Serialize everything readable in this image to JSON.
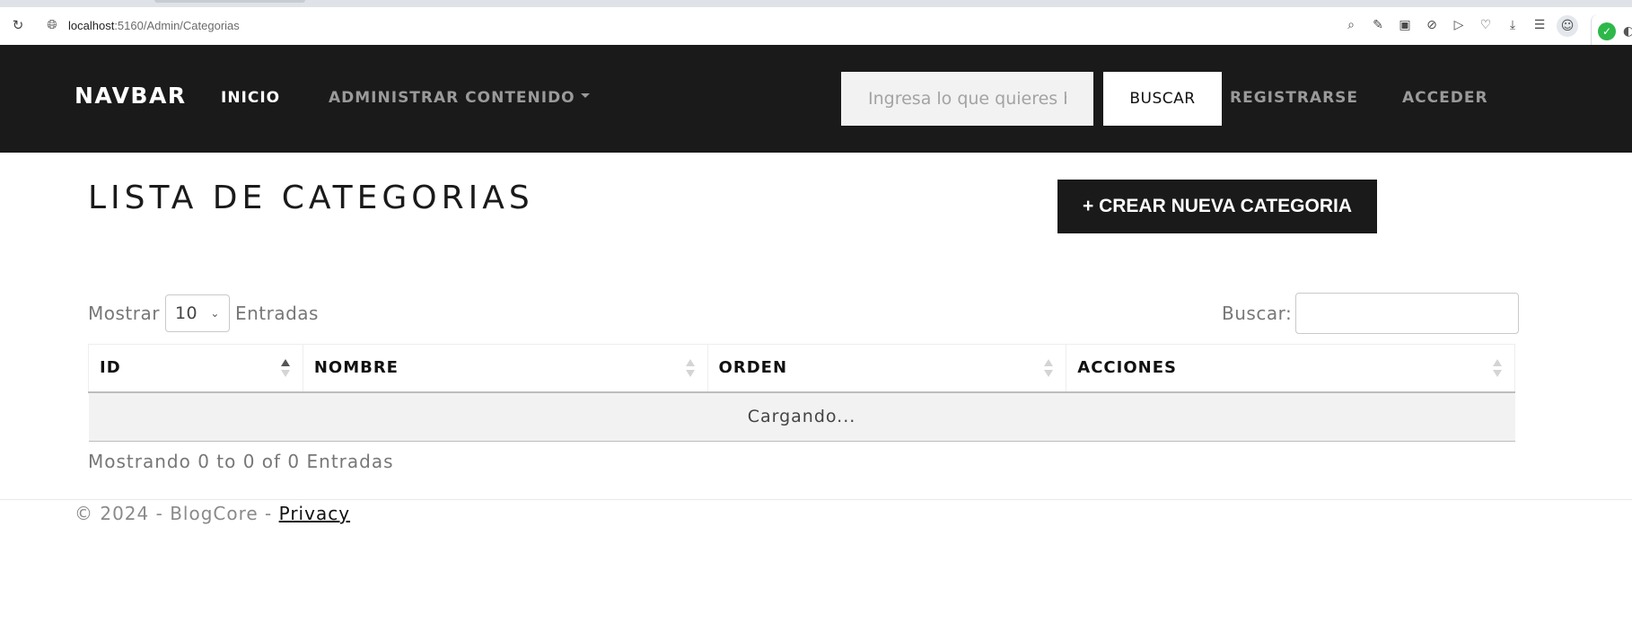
{
  "browser": {
    "url_host": "localhost",
    "url_rest": ":5160/Admin/Categorias",
    "toolbar_icons": [
      "zoom-icon",
      "edit-icon",
      "camera-icon",
      "shield-icon",
      "send-icon",
      "heart-icon",
      "download-icon",
      "menu-icon",
      "profile-icon"
    ]
  },
  "navbar": {
    "brand": "NAVBAR",
    "inicio": "INICIO",
    "admin": "ADMINISTRAR CONTENIDO",
    "search_placeholder": "Ingresa lo que quieres buscar",
    "search_button": "BUSCAR",
    "registrarse": "REGISTRARSE",
    "acceder": "ACCEDER"
  },
  "main": {
    "title": "LISTA DE CATEGORIAS",
    "create_button": "+ CREAR NUEVA CATEGORIA",
    "show_label": "Mostrar",
    "page_length": "10",
    "entries_label": "Entradas",
    "filter_label": "Buscar:",
    "columns": [
      "ID",
      "NOMBRE",
      "ORDEN",
      "ACCIONES"
    ],
    "loading_text": "Cargando...",
    "info_text": "Mostrando 0 to 0 of 0 Entradas"
  },
  "footer": {
    "text": "© 2024 - BlogCore - ",
    "privacy": "Privacy"
  }
}
